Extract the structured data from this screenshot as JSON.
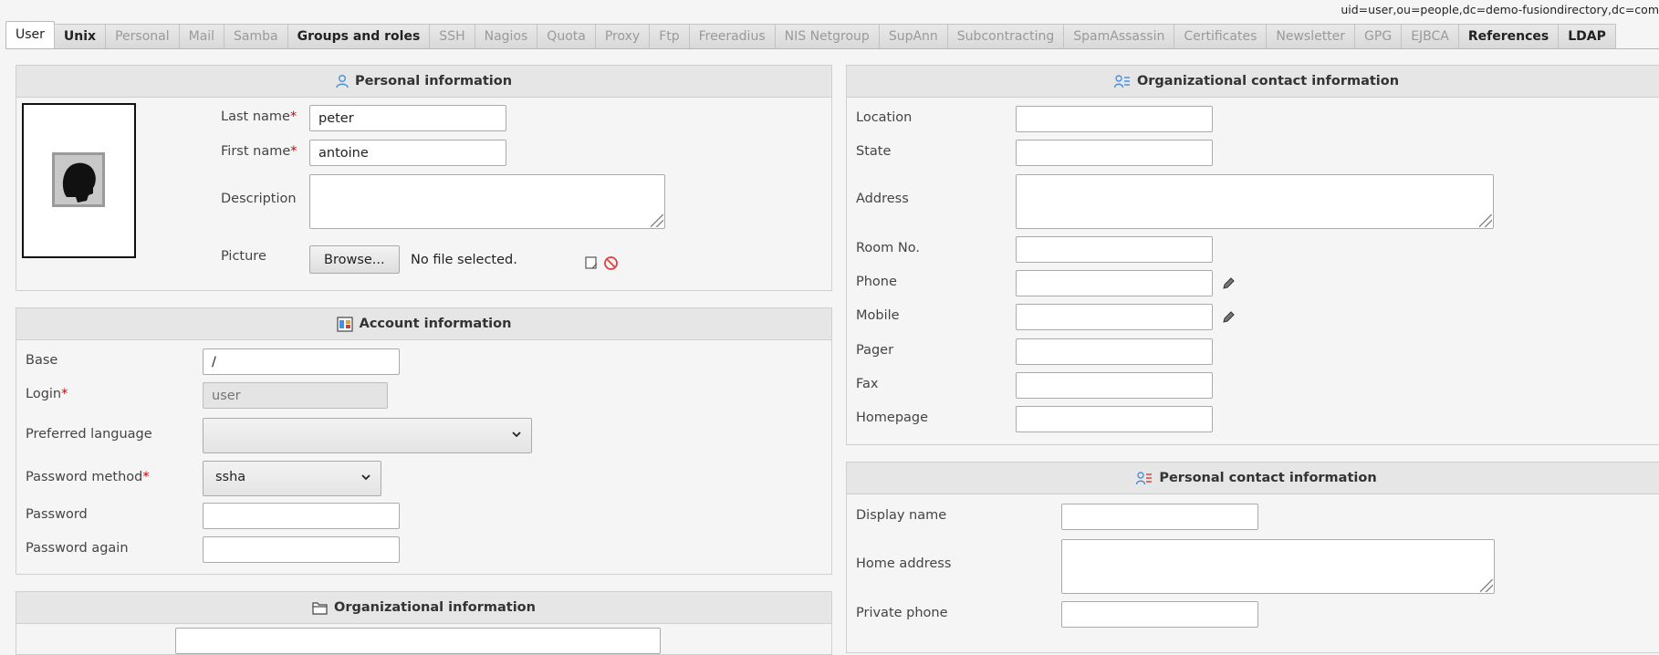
{
  "dn": "uid=user,ou=people,dc=demo-fusiondirectory,dc=com",
  "tabs": [
    {
      "label": "User",
      "state": "active"
    },
    {
      "label": "Unix",
      "state": "enabled"
    },
    {
      "label": "Personal",
      "state": "disabled"
    },
    {
      "label": "Mail",
      "state": "disabled"
    },
    {
      "label": "Samba",
      "state": "disabled"
    },
    {
      "label": "Groups and roles",
      "state": "enabled"
    },
    {
      "label": "SSH",
      "state": "disabled"
    },
    {
      "label": "Nagios",
      "state": "disabled"
    },
    {
      "label": "Quota",
      "state": "disabled"
    },
    {
      "label": "Proxy",
      "state": "disabled"
    },
    {
      "label": "Ftp",
      "state": "disabled"
    },
    {
      "label": "Freeradius",
      "state": "disabled"
    },
    {
      "label": "NIS Netgroup",
      "state": "disabled"
    },
    {
      "label": "SupAnn",
      "state": "disabled"
    },
    {
      "label": "Subcontracting",
      "state": "disabled"
    },
    {
      "label": "SpamAssassin",
      "state": "disabled"
    },
    {
      "label": "Certificates",
      "state": "disabled"
    },
    {
      "label": "Newsletter",
      "state": "disabled"
    },
    {
      "label": "GPG",
      "state": "disabled"
    },
    {
      "label": "EJBCA",
      "state": "disabled"
    },
    {
      "label": "References",
      "state": "enabled"
    },
    {
      "label": "LDAP",
      "state": "enabled"
    }
  ],
  "personal": {
    "title": "Personal information",
    "last_name_label": "Last name",
    "last_name_value": "peter",
    "first_name_label": "First name",
    "first_name_value": "antoine",
    "description_label": "Description",
    "description_value": "",
    "picture_label": "Picture",
    "browse_label": "Browse...",
    "file_status": "No file selected.",
    "required_marker": "*"
  },
  "account": {
    "title": "Account information",
    "base_label": "Base",
    "base_value": "/",
    "login_label": "Login",
    "login_placeholder": "user",
    "language_label": "Preferred language",
    "language_value": "",
    "pw_method_label": "Password method",
    "pw_method_value": "ssha",
    "password_label": "Password",
    "password_again_label": "Password again"
  },
  "orginfo": {
    "title": "Organizational information"
  },
  "orgcontact": {
    "title": "Organizational contact information",
    "location_label": "Location",
    "state_label": "State",
    "address_label": "Address",
    "room_label": "Room No.",
    "phone_label": "Phone",
    "mobile_label": "Mobile",
    "pager_label": "Pager",
    "fax_label": "Fax",
    "homepage_label": "Homepage"
  },
  "personalcontact": {
    "title": "Personal contact information",
    "display_name_label": "Display name",
    "home_address_label": "Home address",
    "private_phone_label": "Private phone"
  },
  "colors": {
    "required": "#cc0000",
    "icon_blue": "#4a90d9",
    "delete_red": "#e04040"
  }
}
